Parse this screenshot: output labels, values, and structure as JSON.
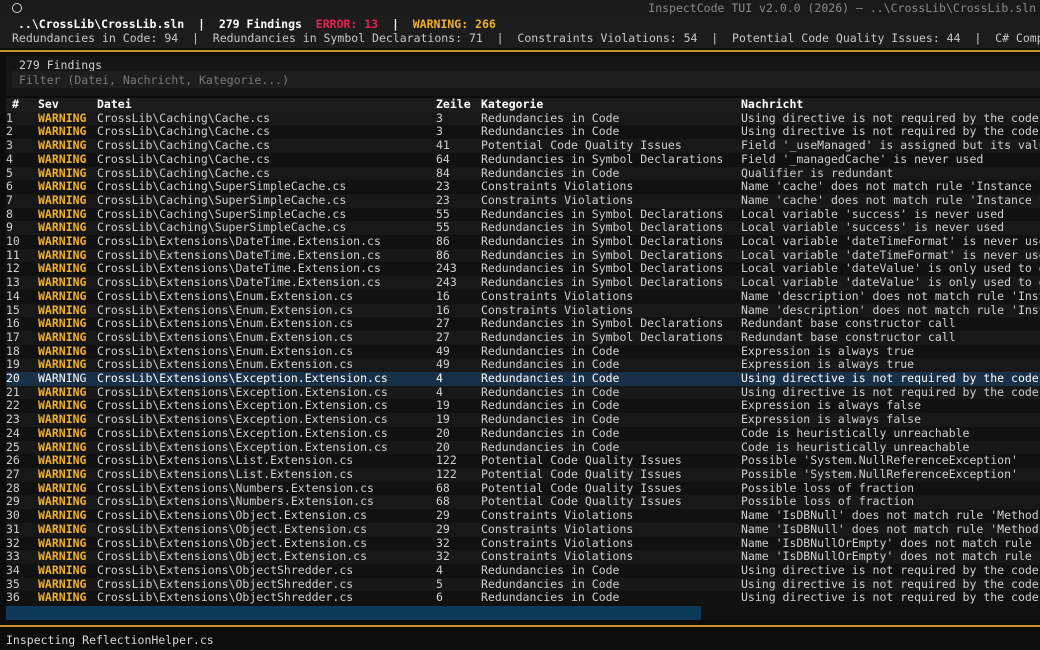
{
  "window": {
    "title": "InspectCode TUI v2.0.0 (2026) — ..\\CrossLib\\CrossLib.sln"
  },
  "summary": {
    "solution": "..\\CrossLib\\CrossLib.sln",
    "findings": "279 Findings",
    "errors": "ERROR: 13",
    "warnings": "WARNING: 266",
    "separator": "|",
    "categories_line": "Redundancies in Code: 94  |  Redundancies in Symbol Declarations: 71  |  Constraints Violations: 54  |  Potential Code Quality Issues: 44  |  C# Compiler Errors"
  },
  "findings_panel": {
    "count_label": "279 Findings",
    "filter_placeholder": "Filter (Datei, Nachricht, Kategorie...)",
    "filter_value": ""
  },
  "table": {
    "columns": [
      "#",
      "Sev",
      "Datei",
      "Zeile",
      "Kategorie",
      "Nachricht"
    ],
    "selected_row": 20,
    "rows": [
      {
        "n": "1",
        "sev": "WARNING",
        "file": "CrossLib\\Caching\\Cache.cs",
        "line": "3",
        "cat": "Redundancies in Code",
        "msg": "Using directive is not required by the code a"
      },
      {
        "n": "2",
        "sev": "WARNING",
        "file": "CrossLib\\Caching\\Cache.cs",
        "line": "3",
        "cat": "Redundancies in Code",
        "msg": "Using directive is not required by the code a"
      },
      {
        "n": "3",
        "sev": "WARNING",
        "file": "CrossLib\\Caching\\Cache.cs",
        "line": "41",
        "cat": "Potential Code Quality Issues",
        "msg": "Field '_useManaged' is assigned but its value"
      },
      {
        "n": "4",
        "sev": "WARNING",
        "file": "CrossLib\\Caching\\Cache.cs",
        "line": "64",
        "cat": "Redundancies in Symbol Declarations",
        "msg": "Field '_managedCache' is never used"
      },
      {
        "n": "5",
        "sev": "WARNING",
        "file": "CrossLib\\Caching\\Cache.cs",
        "line": "84",
        "cat": "Redundancies in Code",
        "msg": "Qualifier is redundant"
      },
      {
        "n": "6",
        "sev": "WARNING",
        "file": "CrossLib\\Caching\\SuperSimpleCache.cs",
        "line": "23",
        "cat": "Constraints Violations",
        "msg": "Name 'cache' does not match rule 'Instance fi"
      },
      {
        "n": "7",
        "sev": "WARNING",
        "file": "CrossLib\\Caching\\SuperSimpleCache.cs",
        "line": "23",
        "cat": "Constraints Violations",
        "msg": "Name 'cache' does not match rule 'Instance fi"
      },
      {
        "n": "8",
        "sev": "WARNING",
        "file": "CrossLib\\Caching\\SuperSimpleCache.cs",
        "line": "55",
        "cat": "Redundancies in Symbol Declarations",
        "msg": "Local variable 'success' is never used"
      },
      {
        "n": "9",
        "sev": "WARNING",
        "file": "CrossLib\\Caching\\SuperSimpleCache.cs",
        "line": "55",
        "cat": "Redundancies in Symbol Declarations",
        "msg": "Local variable 'success' is never used"
      },
      {
        "n": "10",
        "sev": "WARNING",
        "file": "CrossLib\\Extensions\\DateTime.Extension.cs",
        "line": "86",
        "cat": "Redundancies in Symbol Declarations",
        "msg": "Local variable 'dateTimeFormat' is never used"
      },
      {
        "n": "11",
        "sev": "WARNING",
        "file": "CrossLib\\Extensions\\DateTime.Extension.cs",
        "line": "86",
        "cat": "Redundancies in Symbol Declarations",
        "msg": "Local variable 'dateTimeFormat' is never used"
      },
      {
        "n": "12",
        "sev": "WARNING",
        "file": "CrossLib\\Extensions\\DateTime.Extension.cs",
        "line": "243",
        "cat": "Redundancies in Symbol Declarations",
        "msg": "Local variable 'dateValue' is only used to di"
      },
      {
        "n": "13",
        "sev": "WARNING",
        "file": "CrossLib\\Extensions\\DateTime.Extension.cs",
        "line": "243",
        "cat": "Redundancies in Symbol Declarations",
        "msg": "Local variable 'dateValue' is only used to di"
      },
      {
        "n": "14",
        "sev": "WARNING",
        "file": "CrossLib\\Extensions\\Enum.Extension.cs",
        "line": "16",
        "cat": "Constraints Violations",
        "msg": "Name 'description' does not match rule 'Insta"
      },
      {
        "n": "15",
        "sev": "WARNING",
        "file": "CrossLib\\Extensions\\Enum.Extension.cs",
        "line": "16",
        "cat": "Constraints Violations",
        "msg": "Name 'description' does not match rule 'Insta"
      },
      {
        "n": "16",
        "sev": "WARNING",
        "file": "CrossLib\\Extensions\\Enum.Extension.cs",
        "line": "27",
        "cat": "Redundancies in Symbol Declarations",
        "msg": "Redundant base constructor call"
      },
      {
        "n": "17",
        "sev": "WARNING",
        "file": "CrossLib\\Extensions\\Enum.Extension.cs",
        "line": "27",
        "cat": "Redundancies in Symbol Declarations",
        "msg": "Redundant base constructor call"
      },
      {
        "n": "18",
        "sev": "WARNING",
        "file": "CrossLib\\Extensions\\Enum.Extension.cs",
        "line": "49",
        "cat": "Redundancies in Code",
        "msg": "Expression is always true"
      },
      {
        "n": "19",
        "sev": "WARNING",
        "file": "CrossLib\\Extensions\\Enum.Extension.cs",
        "line": "49",
        "cat": "Redundancies in Code",
        "msg": "Expression is always true"
      },
      {
        "n": "20",
        "sev": "WARNING",
        "file": "CrossLib\\Extensions\\Exception.Extension.cs",
        "line": "4",
        "cat": "Redundancies in Code",
        "msg": "Using directive is not required by the code a"
      },
      {
        "n": "21",
        "sev": "WARNING",
        "file": "CrossLib\\Extensions\\Exception.Extension.cs",
        "line": "4",
        "cat": "Redundancies in Code",
        "msg": "Using directive is not required by the code a"
      },
      {
        "n": "22",
        "sev": "WARNING",
        "file": "CrossLib\\Extensions\\Exception.Extension.cs",
        "line": "19",
        "cat": "Redundancies in Code",
        "msg": "Expression is always false"
      },
      {
        "n": "23",
        "sev": "WARNING",
        "file": "CrossLib\\Extensions\\Exception.Extension.cs",
        "line": "19",
        "cat": "Redundancies in Code",
        "msg": "Expression is always false"
      },
      {
        "n": "24",
        "sev": "WARNING",
        "file": "CrossLib\\Extensions\\Exception.Extension.cs",
        "line": "20",
        "cat": "Redundancies in Code",
        "msg": "Code is heuristically unreachable"
      },
      {
        "n": "25",
        "sev": "WARNING",
        "file": "CrossLib\\Extensions\\Exception.Extension.cs",
        "line": "20",
        "cat": "Redundancies in Code",
        "msg": "Code is heuristically unreachable"
      },
      {
        "n": "26",
        "sev": "WARNING",
        "file": "CrossLib\\Extensions\\List.Extension.cs",
        "line": "122",
        "cat": "Potential Code Quality Issues",
        "msg": "Possible 'System.NullReferenceException'"
      },
      {
        "n": "27",
        "sev": "WARNING",
        "file": "CrossLib\\Extensions\\List.Extension.cs",
        "line": "122",
        "cat": "Potential Code Quality Issues",
        "msg": "Possible 'System.NullReferenceException'"
      },
      {
        "n": "28",
        "sev": "WARNING",
        "file": "CrossLib\\Extensions\\Numbers.Extension.cs",
        "line": "68",
        "cat": "Potential Code Quality Issues",
        "msg": "Possible loss of fraction"
      },
      {
        "n": "29",
        "sev": "WARNING",
        "file": "CrossLib\\Extensions\\Numbers.Extension.cs",
        "line": "68",
        "cat": "Potential Code Quality Issues",
        "msg": "Possible loss of fraction"
      },
      {
        "n": "30",
        "sev": "WARNING",
        "file": "CrossLib\\Extensions\\Object.Extension.cs",
        "line": "29",
        "cat": "Constraints Violations",
        "msg": "Name 'IsDBNull' does not match rule 'Methods'"
      },
      {
        "n": "31",
        "sev": "WARNING",
        "file": "CrossLib\\Extensions\\Object.Extension.cs",
        "line": "29",
        "cat": "Constraints Violations",
        "msg": "Name 'IsDBNull' does not match rule 'Methods'"
      },
      {
        "n": "32",
        "sev": "WARNING",
        "file": "CrossLib\\Extensions\\Object.Extension.cs",
        "line": "32",
        "cat": "Constraints Violations",
        "msg": "Name 'IsDBNullOrEmpty' does not match rule 'M"
      },
      {
        "n": "33",
        "sev": "WARNING",
        "file": "CrossLib\\Extensions\\Object.Extension.cs",
        "line": "32",
        "cat": "Constraints Violations",
        "msg": "Name 'IsDBNullOrEmpty' does not match rule 'M"
      },
      {
        "n": "34",
        "sev": "WARNING",
        "file": "CrossLib\\Extensions\\ObjectShredder.cs",
        "line": "4",
        "cat": "Redundancies in Code",
        "msg": "Using directive is not required by the code a"
      },
      {
        "n": "35",
        "sev": "WARNING",
        "file": "CrossLib\\Extensions\\ObjectShredder.cs",
        "line": "5",
        "cat": "Redundancies in Code",
        "msg": "Using directive is not required by the code a"
      },
      {
        "n": "36",
        "sev": "WARNING",
        "file": "CrossLib\\Extensions\\ObjectShredder.cs",
        "line": "6",
        "cat": "Redundancies in Code",
        "msg": "Using directive is not required by the code a"
      }
    ]
  },
  "status": {
    "text": "Inspecting ReflectionHelper.cs"
  },
  "colors": {
    "error": "#e8205a",
    "warning": "#f0b030",
    "accent_rule": "#c89030",
    "selection": "#183048"
  }
}
